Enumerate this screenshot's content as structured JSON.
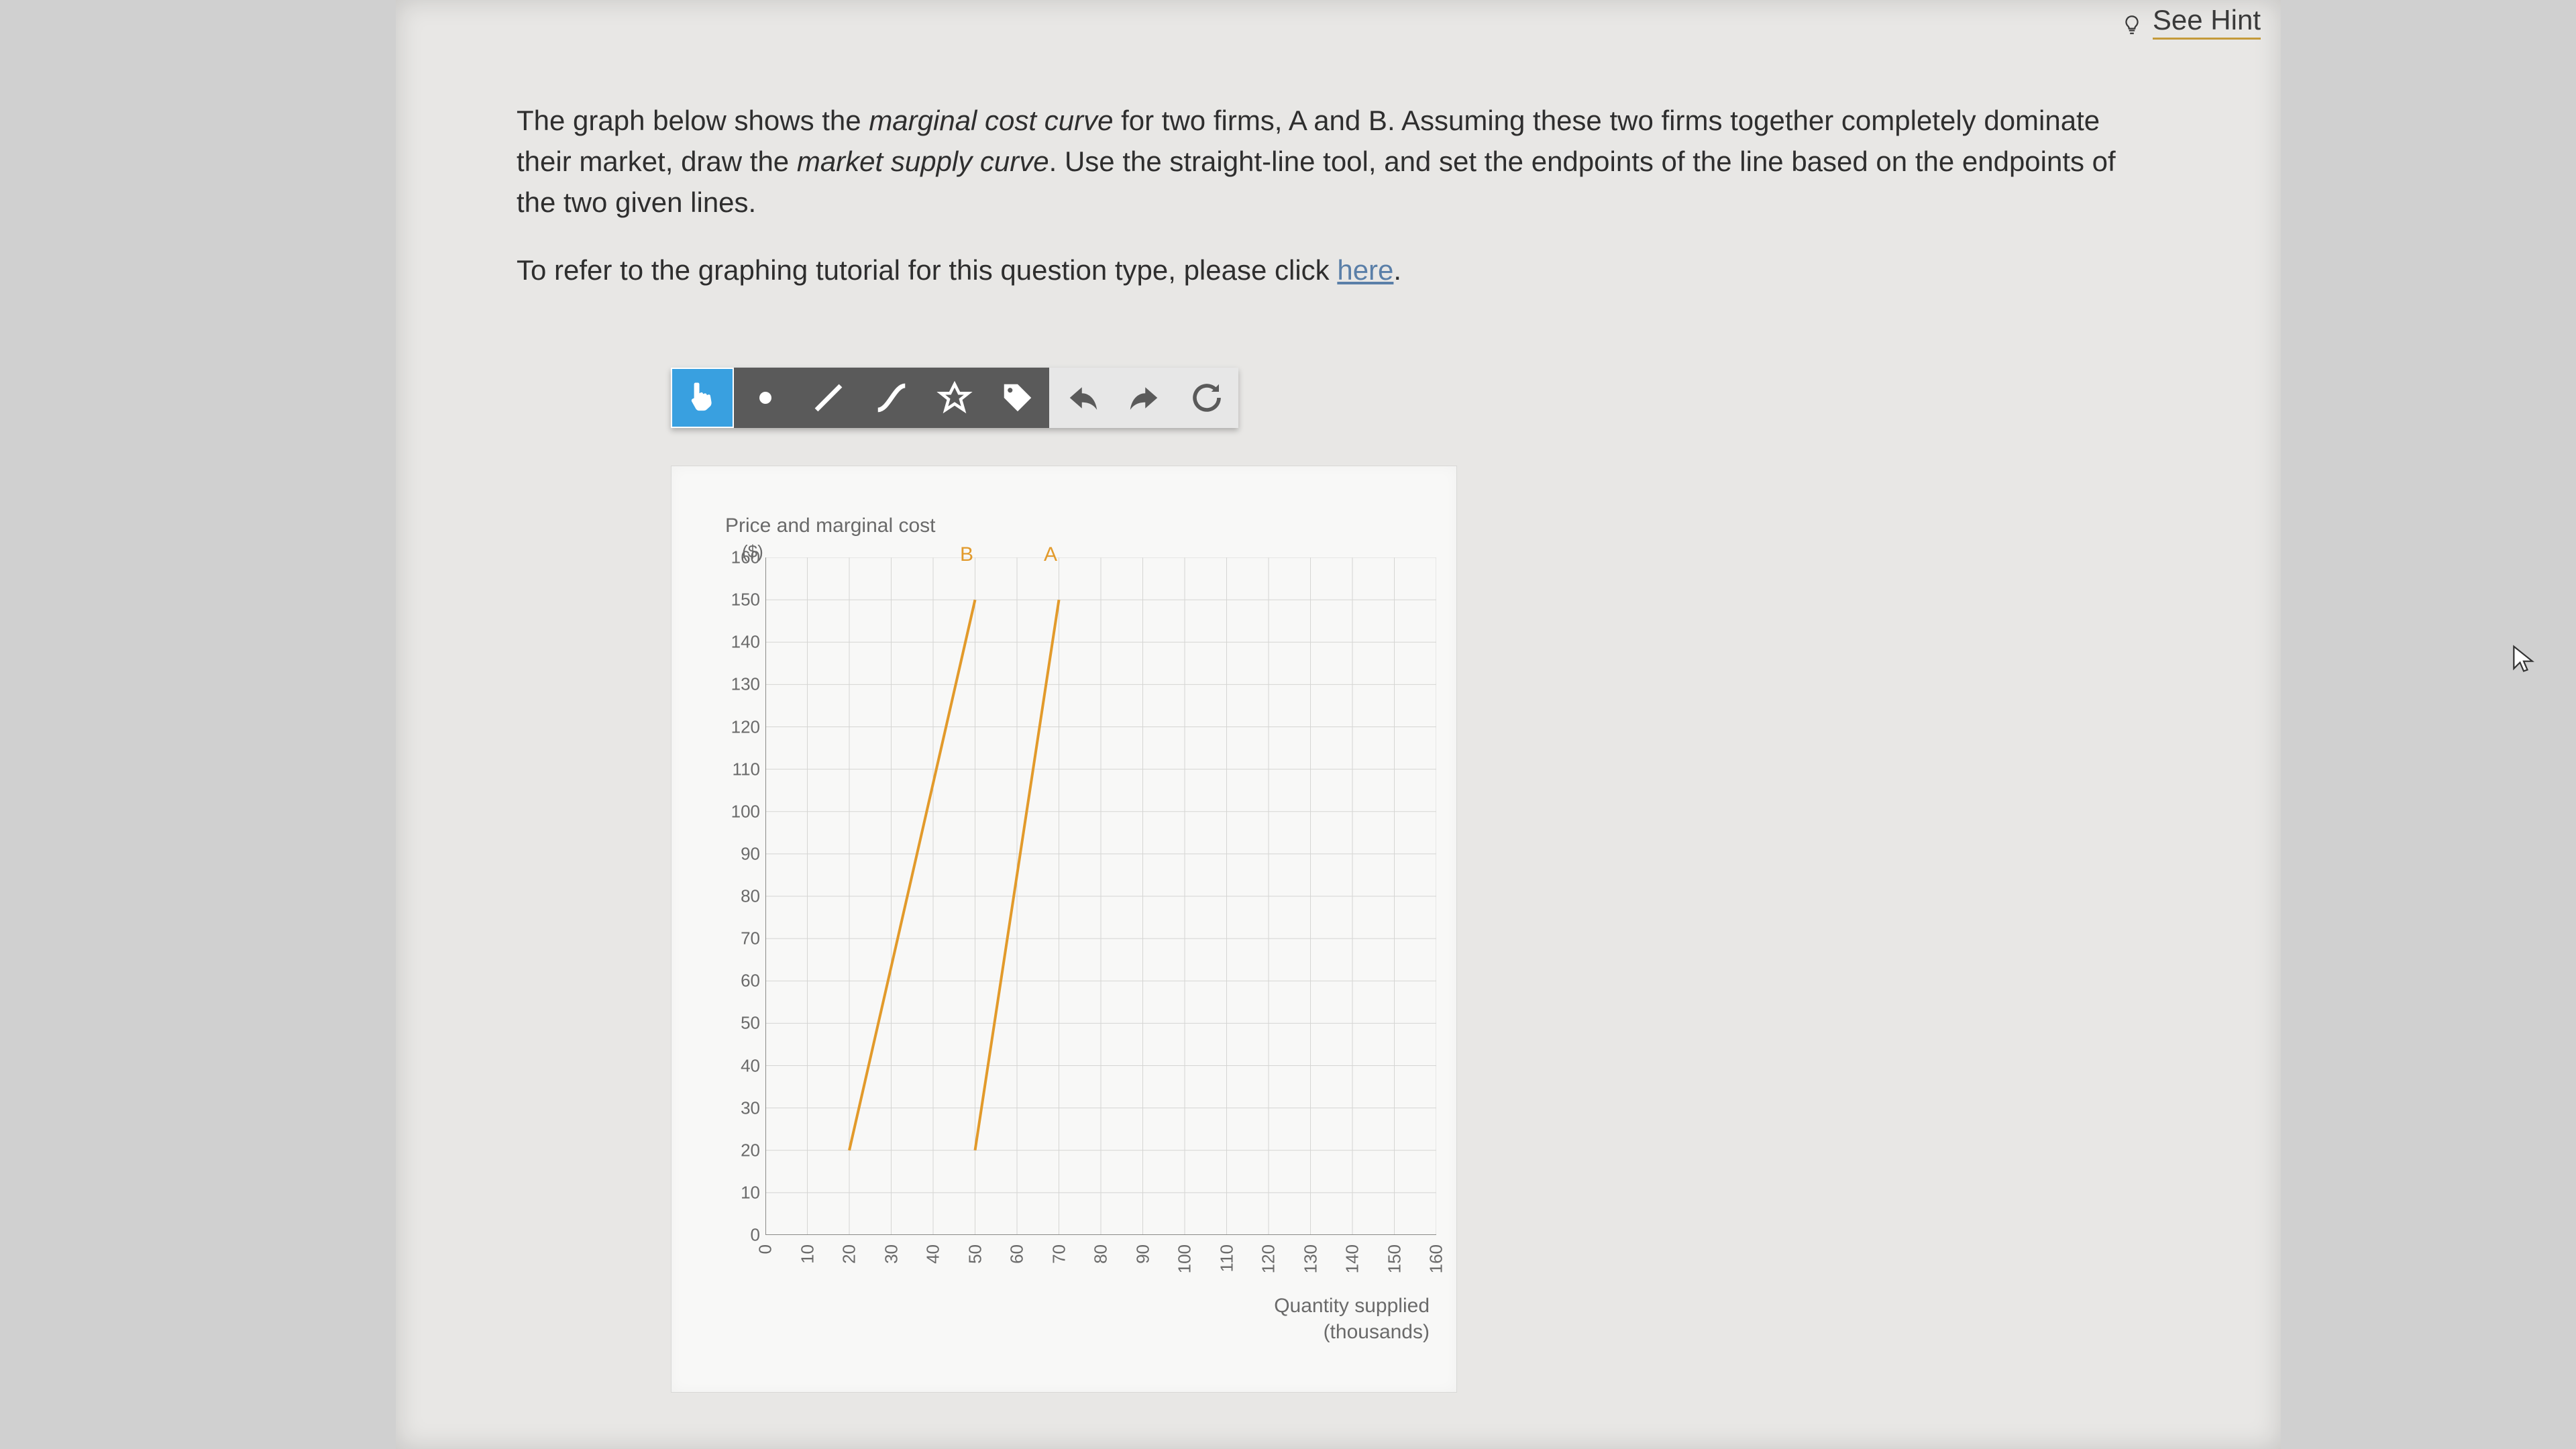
{
  "hint": {
    "label": "See Hint"
  },
  "question": {
    "p1_pre": "The graph below shows the ",
    "p1_em1": "marginal cost curve",
    "p1_mid": " for two firms, A and B. Assuming these two firms together completely dominate their market, draw the ",
    "p1_em2": "market supply curve",
    "p1_post": ". Use the straight-line tool, and set the endpoints of the line based on the endpoints of the two given lines.",
    "p2_pre": "To refer to the graphing tutorial for this question type, please click ",
    "p2_link": "here",
    "p2_post": "."
  },
  "toolbar": {
    "tools": [
      "pointer",
      "point",
      "line",
      "curve",
      "region",
      "label",
      "undo",
      "redo",
      "reset"
    ]
  },
  "chart_data": {
    "type": "line",
    "title": "",
    "ylabel": "Price and marginal cost",
    "yunit": "($)",
    "xlabel": "Quantity supplied",
    "xunit": "(thousands)",
    "xlim": [
      0,
      160
    ],
    "ylim": [
      0,
      160
    ],
    "xticks": [
      0,
      10,
      20,
      30,
      40,
      50,
      60,
      70,
      80,
      90,
      100,
      110,
      120,
      130,
      140,
      150,
      160
    ],
    "yticks": [
      0,
      10,
      20,
      30,
      40,
      50,
      60,
      70,
      80,
      90,
      100,
      110,
      120,
      130,
      140,
      150,
      160
    ],
    "series": [
      {
        "name": "B",
        "x": [
          20,
          50
        ],
        "y": [
          20,
          150
        ]
      },
      {
        "name": "A",
        "x": [
          50,
          70
        ],
        "y": [
          20,
          150
        ]
      }
    ],
    "series_label_pos": {
      "B": [
        48,
        158
      ],
      "A": [
        68,
        158
      ]
    }
  }
}
